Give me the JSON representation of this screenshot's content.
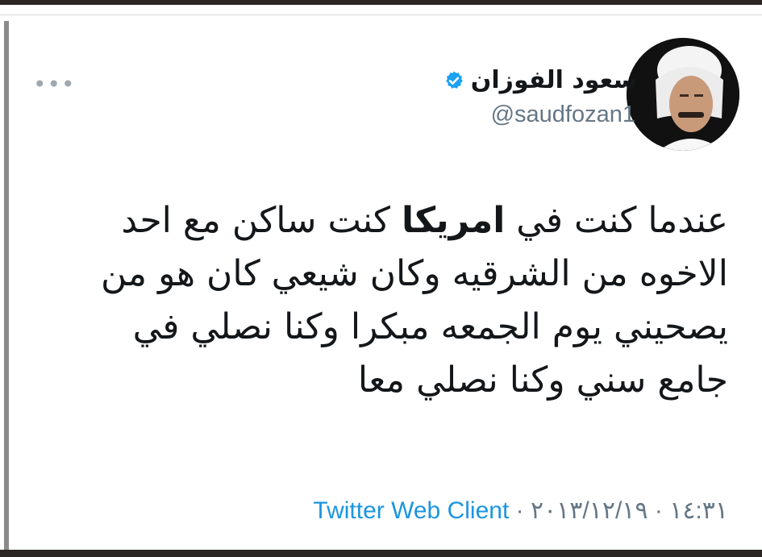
{
  "author": {
    "display_name": "سعود الفوزان",
    "handle": "@saudfozan1",
    "verified": true
  },
  "more_icon": "more-dots-icon",
  "tweet": {
    "part1": "عندما كنت في ",
    "bold": "امريكا",
    "part2": " كنت ساكن مع احد الاخوه من الشرقيه وكان شيعي كان هو من يصحيني يوم الجمعه مبكرا وكنا نصلي في جامع سني وكنا نصلي معا"
  },
  "meta": {
    "date": "٢٠١٣/١٢/١٩",
    "separator": " · ",
    "time": "١٤:٣١",
    "source": "Twitter Web Client"
  },
  "colors": {
    "text": "#14171a",
    "secondary": "#657786",
    "link": "#1b95e0",
    "verified": "#1da1f2"
  }
}
